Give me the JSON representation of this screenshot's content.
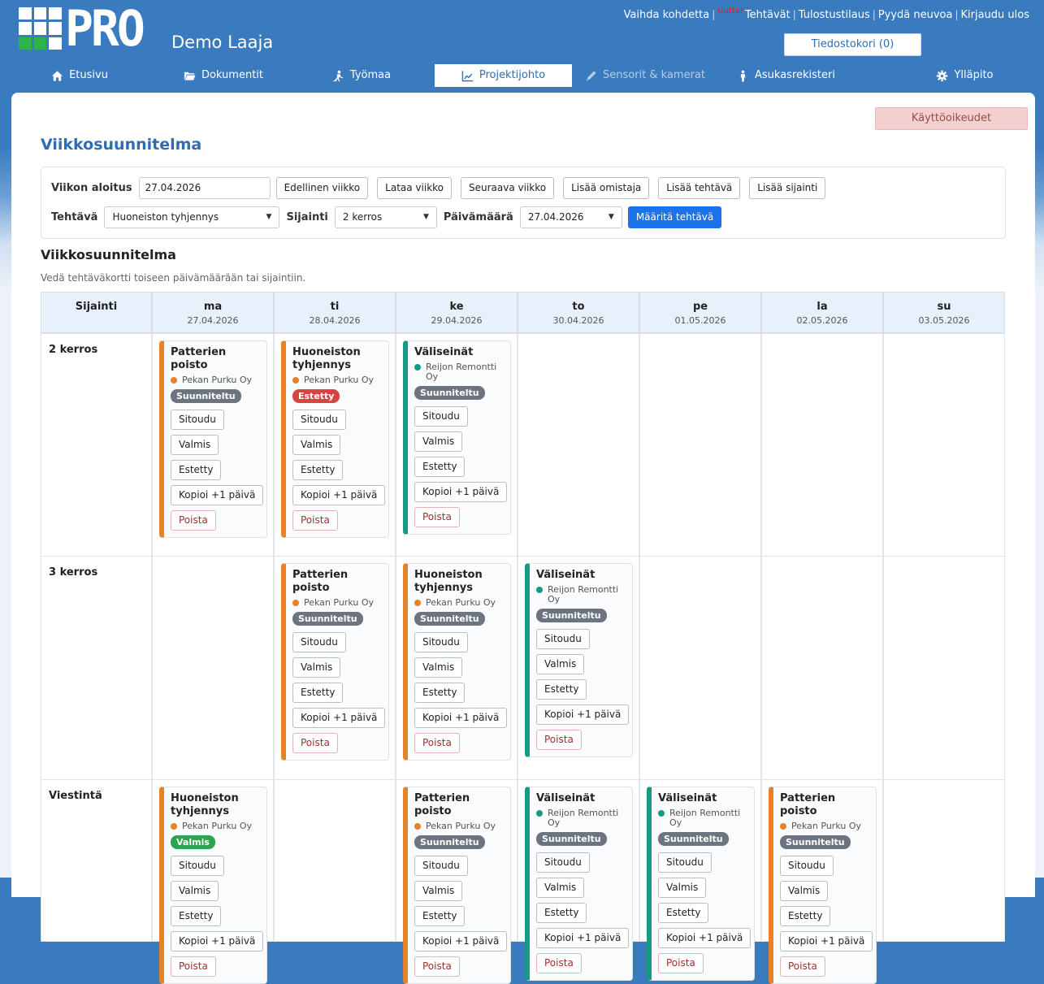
{
  "brand": {
    "logo_text": "PRO",
    "site_title": "Demo Laaja"
  },
  "toplinks": [
    {
      "label": "Vaihda kohdetta"
    },
    {
      "label": "Tehtävät",
      "badge": "Uutta!"
    },
    {
      "label": "Tulostustilaus"
    },
    {
      "label": "Pyydä neuvoa"
    },
    {
      "label": "Kirjaudu ulos"
    }
  ],
  "cart": {
    "label": "Tiedostokori (0)"
  },
  "nav": [
    {
      "label": "Etusivu",
      "icon": "home-icon"
    },
    {
      "label": "Dokumentit",
      "icon": "folder-icon"
    },
    {
      "label": "Työmaa",
      "icon": "worker-icon"
    },
    {
      "label": "Projektijohto",
      "icon": "chart-icon",
      "active": true
    },
    {
      "label": "Sensorit & kamerat",
      "icon": "pencil-icon",
      "disabled": true
    },
    {
      "label": "Asukasrekisteri",
      "icon": "person-icon"
    },
    {
      "label": "Ylläpito",
      "icon": "gear-icon"
    }
  ],
  "permissions_button": "Käyttöoikeudet",
  "page_title": "Viikkosuunnitelma",
  "filters": {
    "week_start_label": "Viikon aloitus",
    "week_start_value": "27.04.2026",
    "prev_week": "Edellinen viikko",
    "load_week": "Lataa viikko",
    "next_week": "Seuraava viikko",
    "add_owner": "Lisää omistaja",
    "add_task": "Lisää tehtävä",
    "add_location": "Lisää sijainti",
    "task_label": "Tehtävä",
    "task_value": "Huoneiston tyhjennys",
    "location_label": "Sijainti",
    "location_value": "2 kerros",
    "date_label": "Päivämäärä",
    "date_value": "27.04.2026",
    "assign_button": "Määritä tehtävä"
  },
  "section_title": "Viikkosuunnitelma",
  "hint": "Vedä tehtäväkortti toiseen päivämäärään tai sijaintiin.",
  "grid": {
    "location_header": "Sijainti",
    "days": [
      {
        "day": "ma",
        "date": "27.04.2026"
      },
      {
        "day": "ti",
        "date": "28.04.2026"
      },
      {
        "day": "ke",
        "date": "29.04.2026"
      },
      {
        "day": "to",
        "date": "30.04.2026"
      },
      {
        "day": "pe",
        "date": "01.05.2026"
      },
      {
        "day": "la",
        "date": "02.05.2026"
      },
      {
        "day": "su",
        "date": "03.05.2026"
      }
    ],
    "card_buttons": {
      "engage": "Sitoudu",
      "done": "Valmis",
      "blocked": "Estetty",
      "copy": "Kopioi +1 päivä",
      "delete": "Poista"
    },
    "rows": [
      {
        "location": "2 kerros",
        "cells": [
          {
            "title": "Patterien poisto",
            "owner": "Pekan Purku Oy",
            "color": "#e8822a",
            "status": "Suunniteltu",
            "status_color": "#6c7480"
          },
          {
            "title": "Huoneiston tyhjennys",
            "owner": "Pekan Purku Oy",
            "color": "#e8822a",
            "status": "Estetty",
            "status_color": "#d64541"
          },
          {
            "title": "Väliseinät",
            "owner": "Reijon Remontti Oy",
            "color": "#159a84",
            "status": "Suunniteltu",
            "status_color": "#6c7480"
          },
          null,
          null,
          null,
          null
        ]
      },
      {
        "location": "3 kerros",
        "cells": [
          null,
          {
            "title": "Patterien poisto",
            "owner": "Pekan Purku Oy",
            "color": "#e8822a",
            "status": "Suunniteltu",
            "status_color": "#6c7480"
          },
          {
            "title": "Huoneiston tyhjennys",
            "owner": "Pekan Purku Oy",
            "color": "#e8822a",
            "status": "Suunniteltu",
            "status_color": "#6c7480"
          },
          {
            "title": "Väliseinät",
            "owner": "Reijon Remontti Oy",
            "color": "#159a84",
            "status": "Suunniteltu",
            "status_color": "#6c7480"
          },
          null,
          null,
          null
        ]
      },
      {
        "location": "Viestintä",
        "cells": [
          {
            "title": "Huoneiston tyhjennys",
            "owner": "Pekan Purku Oy",
            "color": "#e8822a",
            "status": "Valmis",
            "status_color": "#2ea44f"
          },
          null,
          {
            "title": "Patterien poisto",
            "owner": "Pekan Purku Oy",
            "color": "#e8822a",
            "status": "Suunniteltu",
            "status_color": "#6c7480"
          },
          {
            "title": "Väliseinät",
            "owner": "Reijon Remontti Oy",
            "color": "#159a84",
            "status": "Suunniteltu",
            "status_color": "#6c7480"
          },
          {
            "title": "Väliseinät",
            "owner": "Reijon Remontti Oy",
            "color": "#159a84",
            "status": "Suunniteltu",
            "status_color": "#6c7480"
          },
          {
            "title": "Patterien poisto",
            "owner": "Pekan Purku Oy",
            "color": "#e8822a",
            "status": "Suunniteltu",
            "status_color": "#6c7480"
          },
          null
        ]
      }
    ]
  }
}
